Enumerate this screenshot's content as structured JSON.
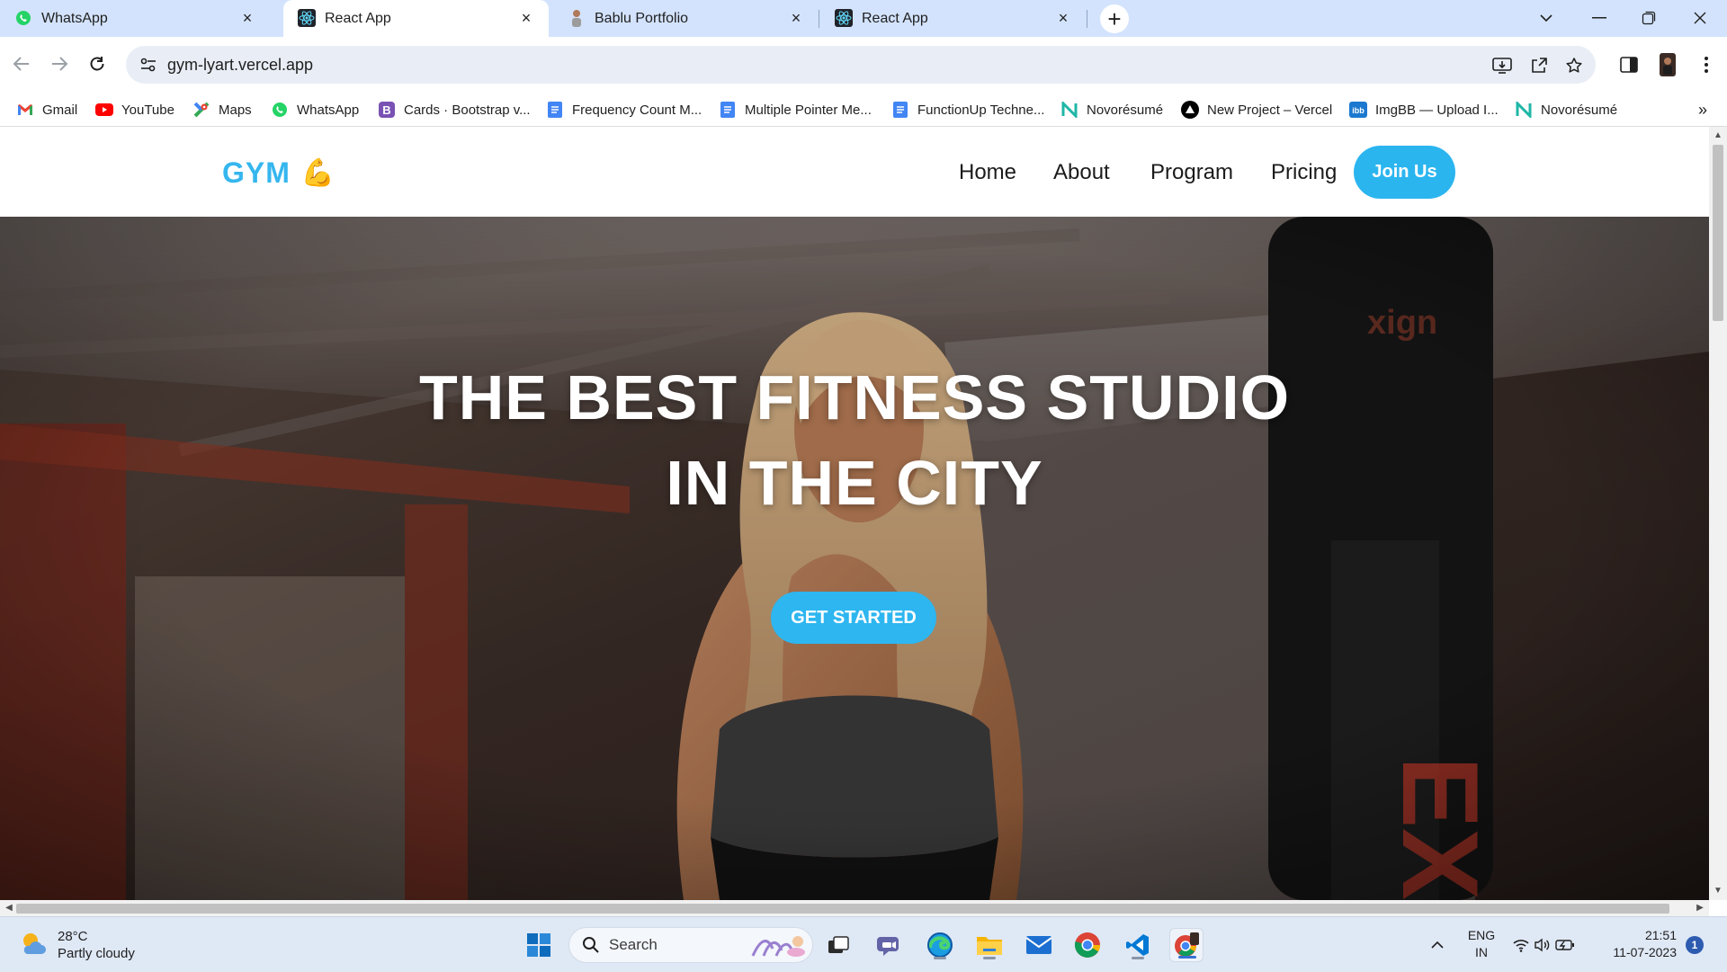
{
  "browser": {
    "tabs": [
      {
        "title": "WhatsApp",
        "favicon": "whatsapp-icon",
        "active": false
      },
      {
        "title": "React App",
        "favicon": "react-icon",
        "active": true
      },
      {
        "title": "Bablu Portfolio",
        "favicon": "person-icon",
        "active": false
      },
      {
        "title": "React App",
        "favicon": "react-icon",
        "active": false
      }
    ],
    "new_tab_symbol": "+",
    "tab_close_symbol": "×",
    "url": "gym-lyart.vercel.app",
    "bookmarks": [
      {
        "label": "Gmail",
        "icon": "gmail-icon"
      },
      {
        "label": "YouTube",
        "icon": "youtube-icon"
      },
      {
        "label": "Maps",
        "icon": "maps-icon"
      },
      {
        "label": "WhatsApp",
        "icon": "whatsapp-icon"
      },
      {
        "label": "Cards · Bootstrap v...",
        "icon": "bootstrap-icon"
      },
      {
        "label": "Frequency Count M...",
        "icon": "docs-icon"
      },
      {
        "label": "Multiple Pointer Me...",
        "icon": "docs-icon"
      },
      {
        "label": "FunctionUp Techne...",
        "icon": "docs-icon"
      },
      {
        "label": "Novorésumé",
        "icon": "novoresume-icon"
      },
      {
        "label": "New Project – Vercel",
        "icon": "vercel-icon"
      },
      {
        "label": "ImgBB — Upload I...",
        "icon": "imgbb-icon"
      },
      {
        "label": "Novorésumé",
        "icon": "novoresume-icon"
      }
    ],
    "bookmarks_overflow": "»"
  },
  "site": {
    "logo_text": "GYM",
    "logo_emoji": "💪",
    "nav": [
      "Home",
      "About",
      "Program",
      "Pricing"
    ],
    "join_button": "Join Us",
    "hero_line1": "THE BEST FITNESS STUDIO",
    "hero_line2": "IN THE CITY",
    "cta": "GET STARTED",
    "accent_color": "#2bb5ef"
  },
  "taskbar": {
    "weather_temp": "28°C",
    "weather_desc": "Partly cloudy",
    "search_label": "Search",
    "lang_line1": "ENG",
    "lang_line2": "IN",
    "time": "21:51",
    "date": "11-07-2023",
    "notification_count": "1"
  }
}
